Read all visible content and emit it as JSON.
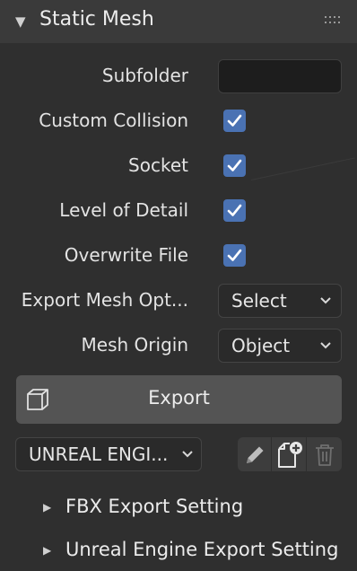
{
  "header": {
    "title": "Static Mesh",
    "collapse_icon": "disclosure-triangle-down",
    "grip_icon": "drag-grip"
  },
  "fields": {
    "subfolder": {
      "label": "Subfolder",
      "value": ""
    },
    "custom_collision": {
      "label": "Custom Collision",
      "checked": true
    },
    "socket": {
      "label": "Socket",
      "checked": true
    },
    "level_of_detail": {
      "label": "Level of Detail",
      "checked": true
    },
    "overwrite_file": {
      "label": "Overwrite File",
      "checked": true
    },
    "export_mesh_options": {
      "label": "Export Mesh Opt...",
      "value": "Select"
    },
    "mesh_origin": {
      "label": "Mesh Origin",
      "value": "Object"
    }
  },
  "export_button": {
    "label": "Export",
    "icon": "cube-icon"
  },
  "preset": {
    "value": "UNREAL ENGI...",
    "edit_icon": "pencil-icon",
    "add_icon": "new-file-icon",
    "delete_icon": "trash-icon"
  },
  "subpanels": [
    {
      "label": "FBX Export Setting",
      "icon": "disclosure-triangle-right"
    },
    {
      "label": "Unreal Engine Export Setting",
      "icon": "disclosure-triangle-right"
    }
  ],
  "colors": {
    "accent": "#4a72b3",
    "panel_bg": "#2f2f2f",
    "header_bg": "#3a3a3a",
    "button_bg": "#545454"
  }
}
